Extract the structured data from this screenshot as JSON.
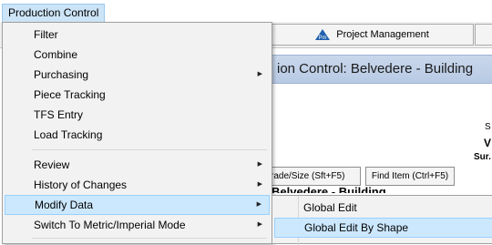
{
  "menubar": {
    "production_control": "Production Control"
  },
  "menu": {
    "items": [
      {
        "label": "Filter"
      },
      {
        "label": "Combine"
      },
      {
        "label": "Purchasing"
      },
      {
        "label": "Piece Tracking"
      },
      {
        "label": "TFS Entry"
      },
      {
        "label": "Load Tracking"
      },
      {
        "label": "Review"
      },
      {
        "label": "History of Changes"
      },
      {
        "label": "Modify Data"
      },
      {
        "label": "Switch To Metric/Imperial Mode"
      }
    ]
  },
  "submenu": {
    "items": [
      {
        "label": "Global Edit"
      },
      {
        "label": "Global Edit By Shape"
      }
    ]
  },
  "background": {
    "project_management_tab": "Project Management",
    "title": "ion Control: Belvedere - Building",
    "grade_size_button": "rade/Size (Sft+F5)",
    "find_item_button": "Find Item (Ctrl+F5)",
    "side_s": "S",
    "side_v": "V",
    "side_sur": "Sur.",
    "subtitle_partial": "Belvedere - Building"
  },
  "colors": {
    "highlight": "#cce8ff",
    "highlight_border": "#99d1ff",
    "menu_bg": "#f2f2f2",
    "title_band": "#c9d7eb"
  }
}
